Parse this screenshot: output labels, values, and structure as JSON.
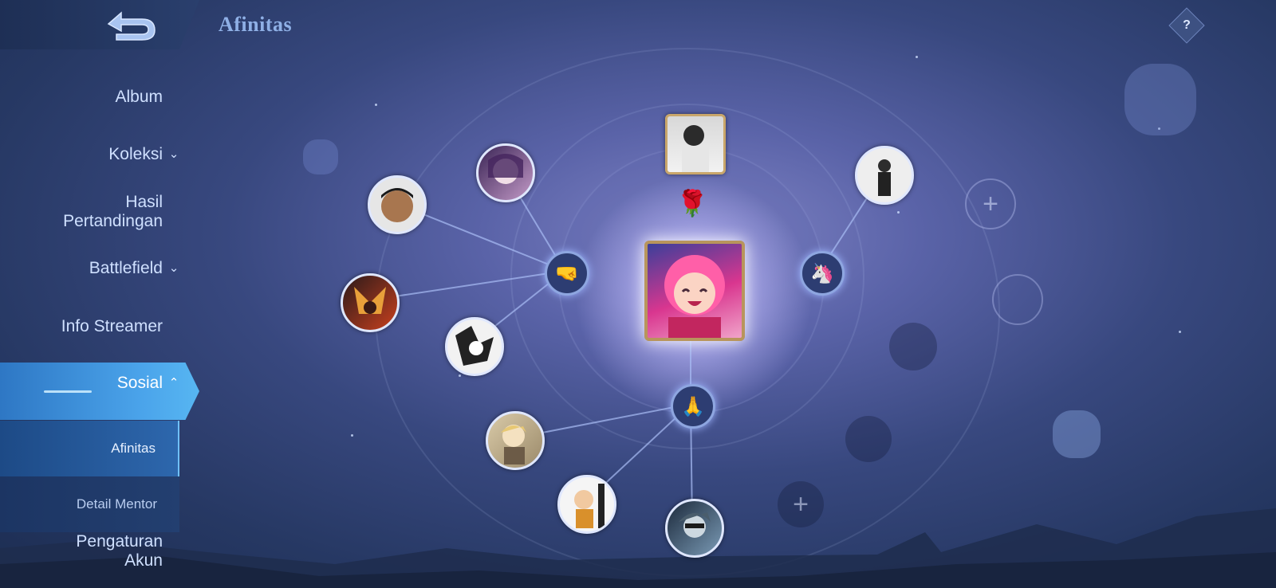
{
  "header": {
    "title": "Afinitas",
    "help_label": "?"
  },
  "sidebar": {
    "items": [
      {
        "label": "Album"
      },
      {
        "label": "Koleksi",
        "has_chevron": "down"
      },
      {
        "label": "Hasil Pertandingan",
        "line1": "Hasil",
        "line2": "Pertandingan"
      },
      {
        "label": "Battlefield",
        "has_chevron": "down"
      },
      {
        "label": "Info Streamer"
      },
      {
        "label": "Sosial",
        "has_chevron": "up",
        "active": true
      },
      {
        "label": "Pengaturan Akun",
        "line1": "Pengaturan",
        "line2": "Akun"
      }
    ],
    "sub_items": [
      {
        "label": "Afinitas",
        "active": true
      },
      {
        "label": "Detail Mentor"
      }
    ],
    "chevron_down": "⌄",
    "chevron_up": "⌃"
  },
  "graph": {
    "hubs": [
      {
        "name": "brotherhood-hub",
        "icon": "fist-bump-icon",
        "glyph": "🤜"
      },
      {
        "name": "bestie-hub",
        "icon": "unicorn-icon",
        "glyph": "🦄"
      },
      {
        "name": "partner-hub",
        "icon": "clapping-hands-icon",
        "glyph": "🙏"
      },
      {
        "name": "romance-marker",
        "icon": "rose-icon",
        "glyph": "🌹"
      }
    ],
    "empty_slot_glyph": "+"
  },
  "colors": {
    "accent": "#4aa3ea",
    "title": "#8fb0e6",
    "background": "#38487f"
  }
}
